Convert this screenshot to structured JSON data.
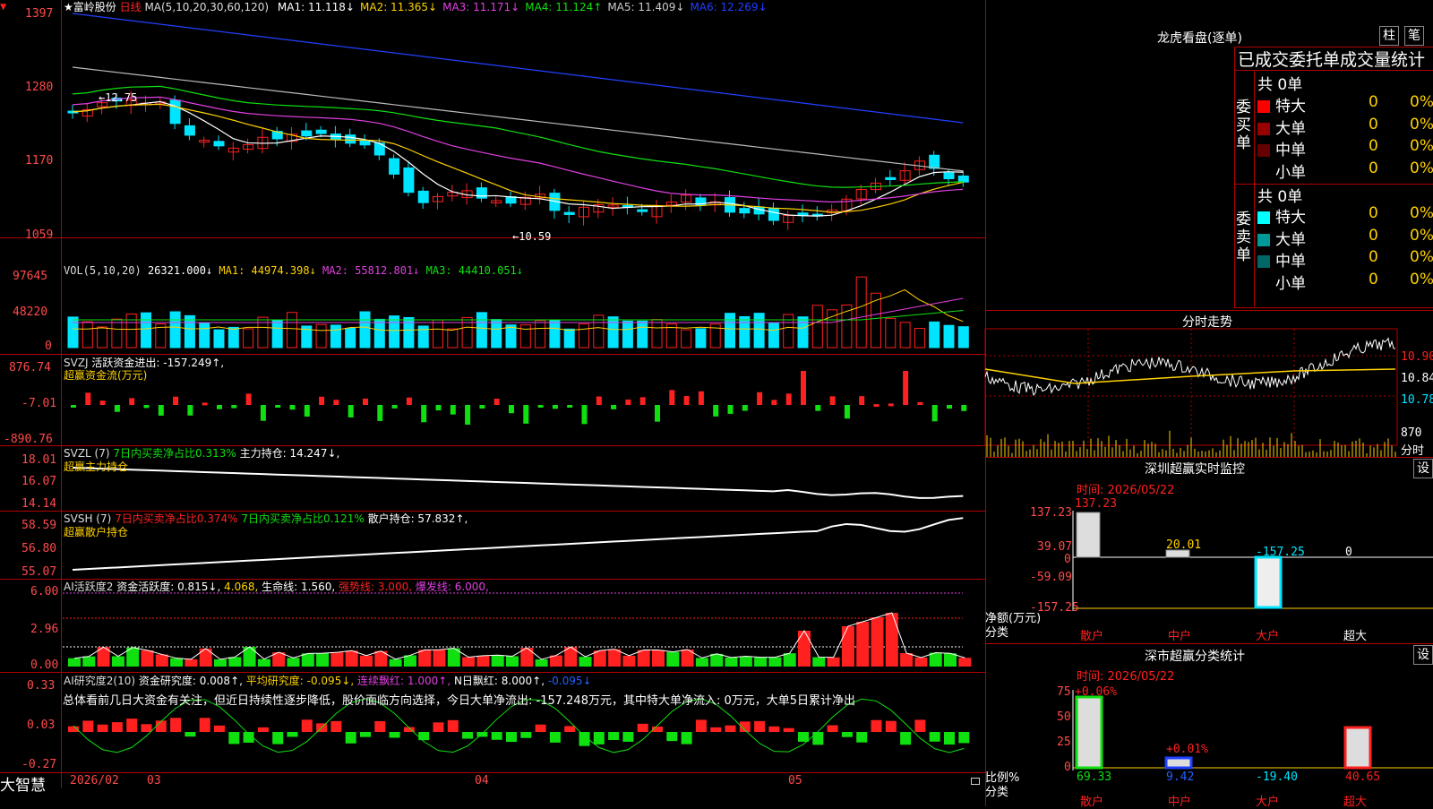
{
  "stock": {
    "name": "★富岭股份",
    "period": "日线"
  },
  "colors": {
    "up": "#ff2020",
    "down": "#00e5ff",
    "green": "#10e010",
    "yellow": "#ffd200",
    "magenta": "#e040e0",
    "bg": "#000000",
    "grid": "#b00000"
  },
  "main": {
    "ma_params": "MA(5,10,20,30,60,120)",
    "ma": [
      {
        "label": "MA1: 11.118↓",
        "color": "#ffffff"
      },
      {
        "label": "MA2: 11.365↓",
        "color": "#ffd200"
      },
      {
        "label": "MA3: 11.171↓",
        "color": "#e040e0"
      },
      {
        "label": "MA4: 11.124↑",
        "color": "#10e010"
      },
      {
        "label": "MA5: 11.409↓",
        "color": "#cccccc"
      },
      {
        "label": "MA6: 12.269↓",
        "color": "#2040ff"
      }
    ],
    "y_labels": [
      "1397",
      "1280",
      "1170",
      "1059"
    ],
    "high_mark": "←12.75",
    "low_mark": "←10.59"
  },
  "vol": {
    "title": "VOL(5,10,20)",
    "value": "26321.000↓",
    "ma1": "MA1: 44974.398↓",
    "ma2": "MA2: 55812.801↓",
    "ma3": "MA3: 44410.051↓",
    "y_labels": [
      "97645",
      "48220",
      "0"
    ]
  },
  "svzj": {
    "title": "SVZJ",
    "value": "活跃资金进出: -157.249↑,",
    "sub": "超赢资金流(万元)",
    "y_labels": [
      "876.74",
      "-7.01",
      "-890.76"
    ]
  },
  "svzl": {
    "title": "SVZL (7)",
    "t1": "7日内买卖净占比0.313%",
    "t2": "主力持仓: 14.247↓,",
    "sub": "超赢主力持仓",
    "y_labels": [
      "18.01",
      "16.07",
      "14.14"
    ]
  },
  "svsh": {
    "title": "SVSH (7)",
    "t1": "7日内买卖净占比0.374%",
    "t2": "7日内买卖净占比0.121%",
    "t3": "散户持仓: 57.832↑,",
    "sub": "超赢散户持仓",
    "y_labels": [
      "58.59",
      "56.80",
      "55.07"
    ]
  },
  "ai1": {
    "title": "AI活跃度2",
    "t1": "资金活跃度: 0.815↓,",
    "t2": "4.068,",
    "t3": "生命线: 1.560,",
    "t4": "强势线: 3.000,",
    "t5": "爆发线: 6.000,",
    "y_labels": [
      "6.00",
      "2.96",
      "0.00"
    ]
  },
  "ai2": {
    "title": "AI研究度2(10)",
    "t1": "资金研究度: 0.008↑,",
    "t2": "平均研究度: -0.095↓,",
    "t3": "连续飘红: 1.000↑,",
    "t4": "N日飘红: 8.000↑,",
    "t5": "-0.095↓",
    "summary": "总体看前几日大资金有关注，但近日持续性逐步降低，股价面临方向选择，今日大单净流出: -157.248万元，其中特大单净流入: 0万元，大单5日累计净出",
    "y_labels": [
      "0.33",
      "0.03",
      "-0.27"
    ]
  },
  "bottom": {
    "brand": "大智慧",
    "dates": [
      "2026/02",
      "03",
      "04",
      "05"
    ]
  },
  "right": {
    "lhb_title": "龙虎看盘(逐单)",
    "btn_zhu": "柱",
    "btn_bi": "笔",
    "tabs": "已成交委托单成交量统计",
    "buy_label": "委买单",
    "sell_label": "委卖单",
    "buy_total": "共 0单",
    "sell_total": "共 0单",
    "buy_rows": [
      {
        "name": "特大",
        "n": "0",
        "p": "0%",
        "color": "#ff0000"
      },
      {
        "name": "大单",
        "n": "0",
        "p": "0%",
        "color": "#990000"
      },
      {
        "name": "中单",
        "n": "0",
        "p": "0%",
        "color": "#660000"
      },
      {
        "name": "小单",
        "n": "0",
        "p": "0%",
        "color": "#000000"
      }
    ],
    "sell_rows": [
      {
        "name": "特大",
        "n": "0",
        "p": "0%",
        "color": "#00ffff"
      },
      {
        "name": "大单",
        "n": "0",
        "p": "0%",
        "color": "#009999"
      },
      {
        "name": "中单",
        "n": "0",
        "p": "0%",
        "color": "#006666"
      },
      {
        "name": "小单",
        "n": "0",
        "p": "0%",
        "color": "#000000"
      }
    ],
    "fs_title": "分时走势",
    "fs_prices": [
      "10.90",
      "10.84",
      "10.78"
    ],
    "fs_vol": "870",
    "fs_vol_label": "分时",
    "sz_title": "深圳超赢实时监控",
    "sz_btn": "设",
    "sz_time": "时间: 2026/05/22",
    "sz_y": [
      "137.23",
      "39.07",
      "0",
      "-59.09",
      "-157.25"
    ],
    "sz_values": [
      "137.23",
      "20.01",
      "-157.25",
      "0"
    ],
    "sz_axis_label1": "净额(万元)",
    "sz_axis_label2": "分类",
    "cats": [
      "散户",
      "中户",
      "大户",
      "超大"
    ],
    "ss_title": "深市超赢分类统计",
    "ss_btn": "设",
    "ss_time": "时间: 2026/05/22",
    "ss_y": [
      "75",
      "50",
      "25",
      "0"
    ],
    "ss_tops": [
      "+0.06%",
      "+0.01%"
    ],
    "ss_values": [
      "69.33",
      "9.42",
      "-19.40",
      "40.65"
    ],
    "ss_axis_label1": "比例%",
    "ss_axis_label2": "分类"
  }
}
